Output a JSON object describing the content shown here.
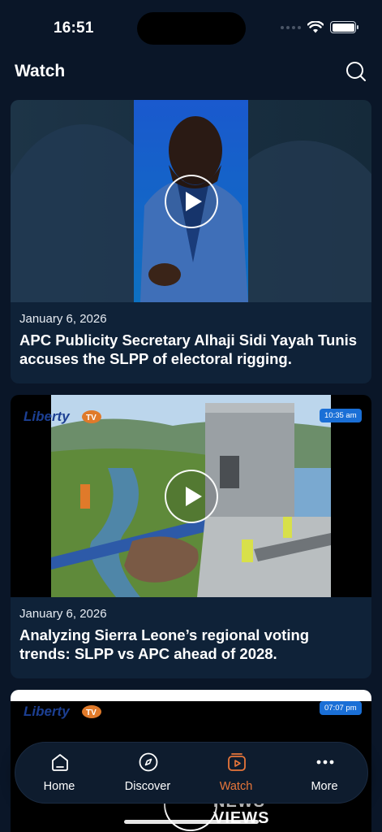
{
  "status_bar": {
    "time": "16:51"
  },
  "header": {
    "title": "Watch"
  },
  "feed": [
    {
      "date": "January 6, 2026",
      "title": "APC Publicity Secretary Alhaji Sidi Yayah Tunis accuses the SLPP of electoral rigging."
    },
    {
      "date": "January 6, 2026",
      "title": "Analyzing Sierra Leone’s regional voting trends: SLPP vs APC ahead of 2028.",
      "badge": "10:35 am",
      "logo_text": "Liberty TV"
    },
    {
      "badge": "07:07 pm",
      "logo_text": "Liberty TV",
      "overlay_line1": "NEWS",
      "overlay_line2": "VIEWS"
    }
  ],
  "tabs": [
    {
      "label": "Home",
      "icon": "home-icon"
    },
    {
      "label": "Discover",
      "icon": "compass-icon"
    },
    {
      "label": "Watch",
      "icon": "watch-icon"
    },
    {
      "label": "More",
      "icon": "more-icon"
    }
  ],
  "colors": {
    "background": "#0a1628",
    "card": "#0f2238",
    "accent": "#e8763a",
    "badge": "#1a6fd6"
  }
}
